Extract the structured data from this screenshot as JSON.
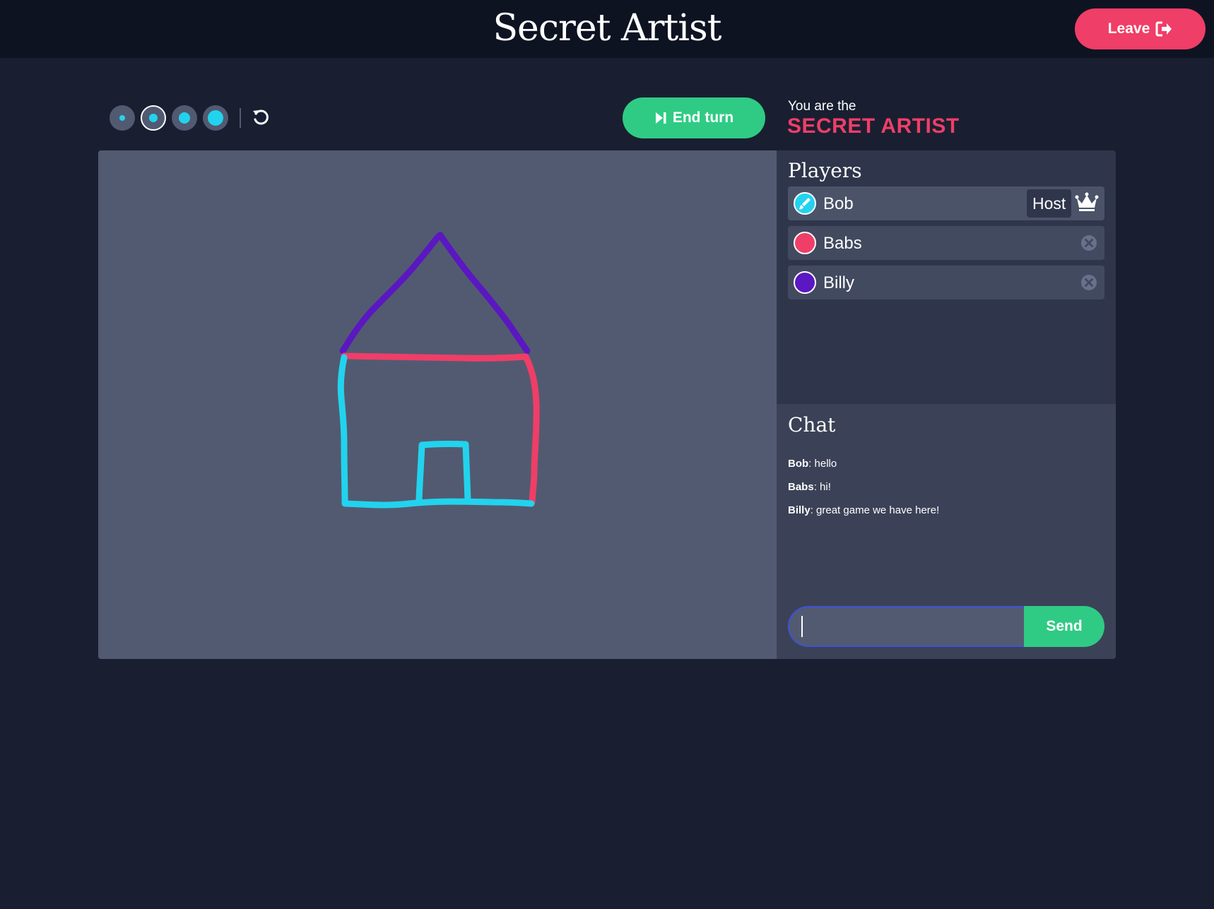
{
  "header": {
    "title": "Secret Artist",
    "leave_label": "Leave"
  },
  "toolbar": {
    "brush_sizes": [
      "small",
      "medium",
      "large",
      "extra-large"
    ],
    "selected_brush": "medium",
    "brush_color": "#22d3ee",
    "end_turn_label": "End turn"
  },
  "role": {
    "intro": "You are the",
    "name": "SECRET ARTIST"
  },
  "players": {
    "title": "Players",
    "list": [
      {
        "name": "Bob",
        "color": "#22d3ee",
        "badge": "Host",
        "active": true,
        "icon": "brush-icon"
      },
      {
        "name": "Babs",
        "color": "#ef3e67",
        "active": false
      },
      {
        "name": "Billy",
        "color": "#5b17c1",
        "active": false
      }
    ]
  },
  "chat": {
    "title": "Chat",
    "messages": [
      {
        "author": "Bob",
        "text": "hello"
      },
      {
        "author": "Babs",
        "text": "hi!"
      },
      {
        "author": "Billy",
        "text": "great game we have here!"
      }
    ],
    "input_value": "",
    "send_label": "Send"
  },
  "colors": {
    "background": "#191f31",
    "header": "#0e1322",
    "accent_pink": "#ef3e67",
    "accent_green": "#2fcb85",
    "canvas": "#525a71",
    "stroke_cyan": "#22d3ee",
    "stroke_pink": "#ef3e67",
    "stroke_purple": "#5b17c1"
  }
}
